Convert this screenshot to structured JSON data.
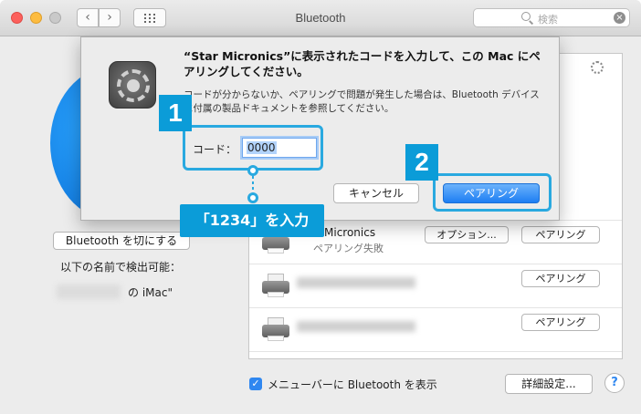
{
  "window": {
    "title": "Bluetooth",
    "search_placeholder": "検索"
  },
  "left_panel": {
    "toggle_button": "Bluetooth を切にする",
    "discoverable_label": "以下の名前で検出可能：",
    "device_name_suffix": "の iMac\""
  },
  "devices": [
    {
      "name": "Micronics",
      "status": "ペアリング失敗",
      "option_label": "オプション...",
      "pair_label": "ペアリング",
      "blurred": false
    },
    {
      "name": "STAR mPOP-XXXX",
      "status": "",
      "pair_label": "ペアリング",
      "blurred": true
    },
    {
      "name": "STAR mPOP-XXXX",
      "status": "",
      "pair_label": "ペアリング",
      "blurred": true
    }
  ],
  "footer": {
    "show_in_menubar_label": "メニューバーに Bluetooth を表示",
    "show_in_menubar_checked": true,
    "advanced_button": "詳細設定...",
    "help_glyph": "?"
  },
  "sheet": {
    "title": "“Star Micronics”に表示されたコードを入力して、この Mac にペアリングしてください。",
    "description": "コードが分からないか、ペアリングで問題が発生した場合は、Bluetooth デバイスに付属の製品ドキュメントを参照してください。",
    "code_label": "コード：",
    "code_value": "0000",
    "cancel_button": "キャンセル",
    "pair_button": "ペアリング"
  },
  "annotations": {
    "step1": "1",
    "step2": "2",
    "callout": "「1234」を入力",
    "highlight_color": "#29a9e0",
    "badge_color": "#0b9cd8"
  }
}
